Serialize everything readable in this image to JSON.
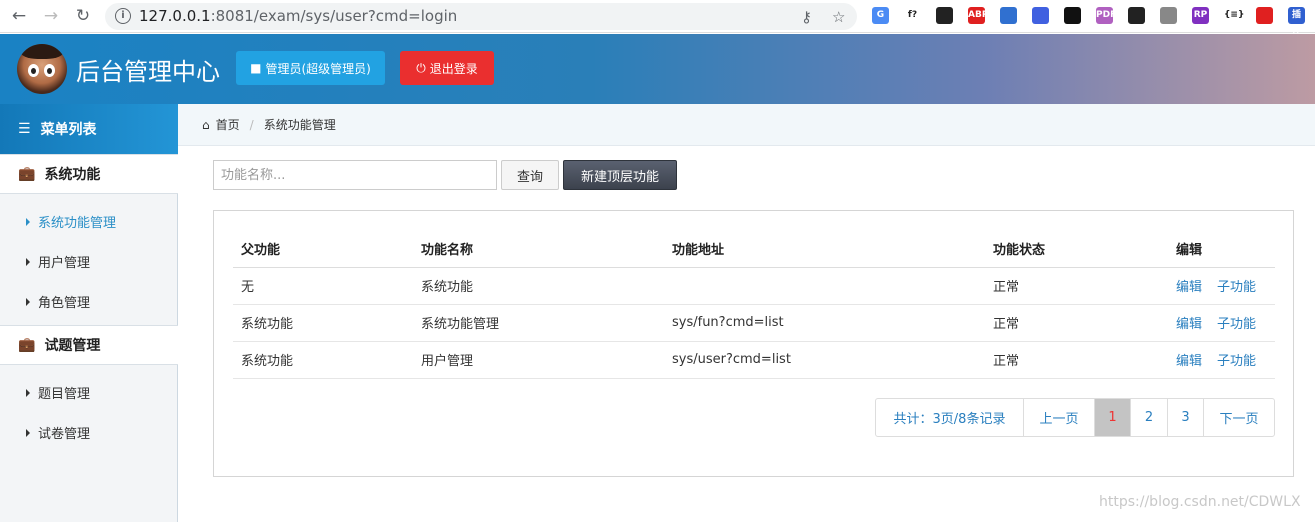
{
  "browser": {
    "url_host": "127.0.0.1",
    "url_rest": ":8081/exam/sys/user?cmd=login",
    "extensions": [
      {
        "label": "G",
        "color": "#4b8bf4"
      },
      {
        "label": "f?",
        "color": "#ffffff"
      },
      {
        "label": "",
        "color": "#222222"
      },
      {
        "label": "ABP",
        "color": "#e02020"
      },
      {
        "label": "",
        "color": "#3070d0"
      },
      {
        "label": "",
        "color": "#4060e0"
      },
      {
        "label": "",
        "color": "#111111"
      },
      {
        "label": "PDF",
        "color": "#b060c0"
      },
      {
        "label": "",
        "color": "#222222"
      },
      {
        "label": "",
        "color": "#888888"
      },
      {
        "label": "RP",
        "color": "#8030c0"
      },
      {
        "label": "{≡}",
        "color": "#ffffff"
      },
      {
        "label": "",
        "color": "#e02020"
      },
      {
        "label": "插件",
        "color": "#3060d0"
      }
    ]
  },
  "header": {
    "title": "后台管理中心",
    "admin_button": "管理员(超级管理员)",
    "logout_button": "退出登录",
    "accent": "#1a82c4"
  },
  "sidebar": {
    "menu_title": "菜单列表",
    "groups": [
      {
        "label": "系统功能",
        "items": [
          "系统功能管理",
          "用户管理",
          "角色管理"
        ]
      },
      {
        "label": "试题管理",
        "items": [
          "题目管理",
          "试卷管理"
        ]
      }
    ]
  },
  "breadcrumb": {
    "home": "首页",
    "current": "系统功能管理"
  },
  "toolbar": {
    "search_placeholder": "功能名称...",
    "query_label": "查询",
    "new_label": "新建顶层功能"
  },
  "table": {
    "headers": [
      "父功能",
      "功能名称",
      "功能地址",
      "功能状态",
      "编辑"
    ],
    "rows": [
      {
        "parent": "无",
        "name": "系统功能",
        "url": "",
        "status": "正常",
        "edit": "编辑",
        "child": "子功能"
      },
      {
        "parent": "系统功能",
        "name": "系统功能管理",
        "url": "sys/fun?cmd=list",
        "status": "正常",
        "edit": "编辑",
        "child": "子功能"
      },
      {
        "parent": "系统功能",
        "name": "用户管理",
        "url": "sys/user?cmd=list",
        "status": "正常",
        "edit": "编辑",
        "child": "子功能"
      }
    ]
  },
  "pagination": {
    "summary": "共计：3页/8条记录",
    "prev": "上一页",
    "pages": [
      "1",
      "2",
      "3"
    ],
    "current": "1",
    "next": "下一页"
  },
  "watermark": "https://blog.csdn.net/CDWLX"
}
